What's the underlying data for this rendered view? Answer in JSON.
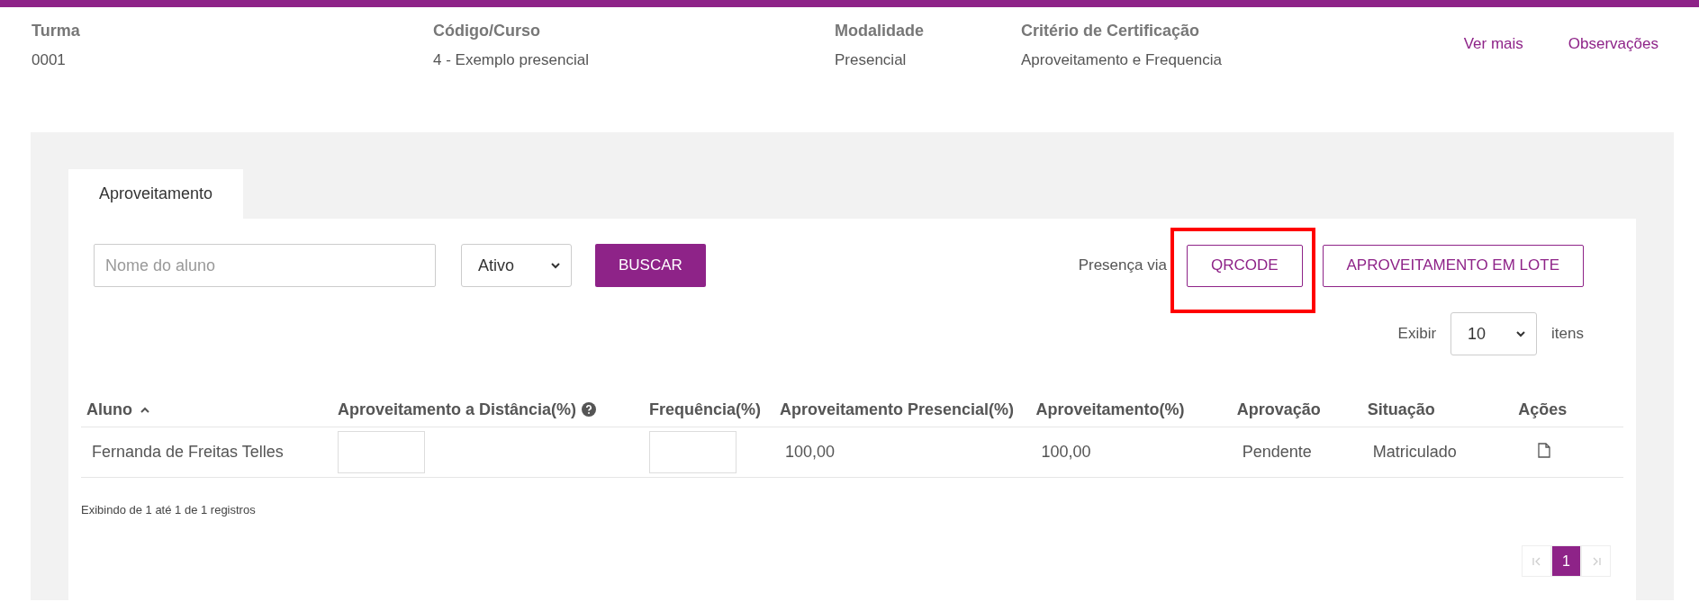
{
  "header": {
    "fields": [
      {
        "label": "Turma",
        "value": "0001"
      },
      {
        "label": "Código/Curso",
        "value": "4 - Exemplo presencial"
      },
      {
        "label": "Modalidade",
        "value": "Presencial"
      },
      {
        "label": "Critério de Certificação",
        "value": "Aproveitamento e Frequencia"
      }
    ],
    "links": [
      "Ver mais",
      "Observações"
    ]
  },
  "tabs": [
    {
      "label": "Aproveitamento",
      "selected": true
    }
  ],
  "filters": {
    "search": {
      "placeholder": "Nome do aluno"
    },
    "status": "Ativo",
    "search_button": "BUSCAR"
  },
  "actions": {
    "label": "Presença via",
    "buttons": [
      {
        "label": "QRCODE",
        "highlighted": true
      },
      {
        "label": "APROVEITAMENTO EM LOTE",
        "highlighted": false
      }
    ]
  },
  "page_size": {
    "label": "Exibir",
    "value": "10",
    "suffix": "itens"
  },
  "table": {
    "columns": [
      {
        "label": "Aluno",
        "sorted": true,
        "help": false
      },
      {
        "label": "Aproveitamento a Distância(%)",
        "sorted": false,
        "help": true
      },
      {
        "label": "Frequência(%)",
        "sorted": false,
        "help": false
      },
      {
        "label": "Aproveitamento Presencial(%)",
        "sorted": false,
        "help": false
      },
      {
        "label": "Aproveitamento(%)",
        "sorted": false,
        "help": false
      },
      {
        "label": "Aprovação",
        "sorted": false,
        "help": false
      },
      {
        "label": "Situação",
        "sorted": false,
        "help": false
      },
      {
        "label": "Ações",
        "sorted": false,
        "help": false
      }
    ],
    "rows": [
      {
        "cells": [
          {
            "kind": "text",
            "text": "Fernanda de Freitas Telles"
          },
          {
            "kind": "input"
          },
          {
            "kind": "input"
          },
          {
            "kind": "text",
            "text": "100,00"
          },
          {
            "kind": "text",
            "text": "100,00"
          },
          {
            "kind": "text",
            "text": "Pendente"
          },
          {
            "kind": "text",
            "text": "Matriculado"
          },
          {
            "kind": "action"
          }
        ]
      }
    ]
  },
  "summary": "Exibindo de 1 até 1 de 1 registros",
  "pagination": {
    "pages": [
      {
        "label": "1",
        "selected": true
      }
    ],
    "first_disabled": true,
    "last_disabled": true
  }
}
